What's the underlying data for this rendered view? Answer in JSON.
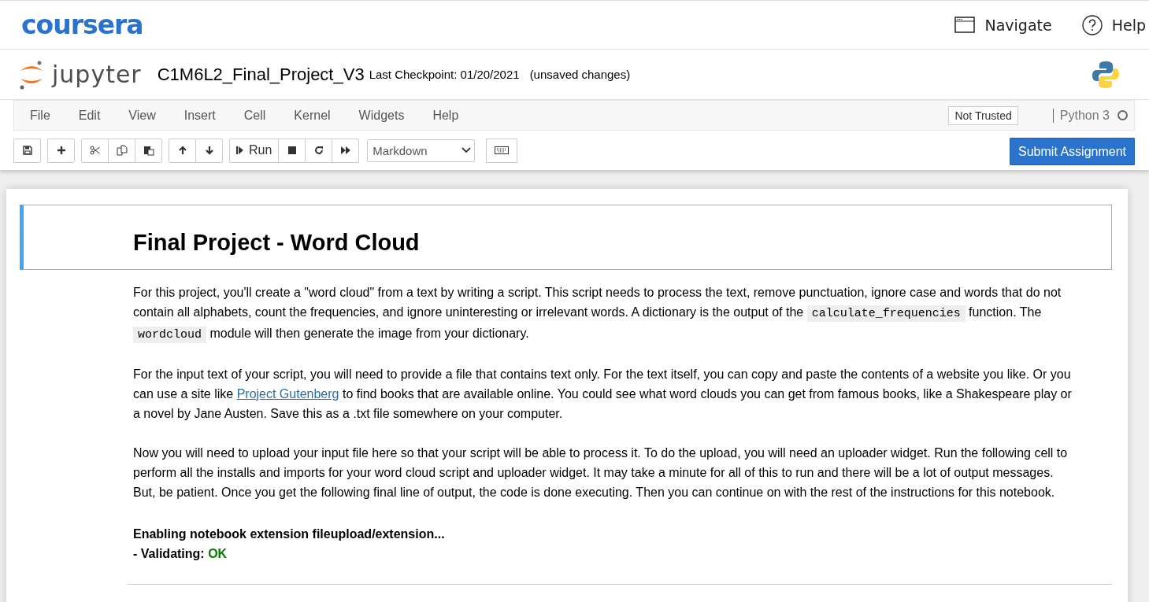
{
  "site_header": {
    "brand": "coursera",
    "links": [
      {
        "kind": "navigate",
        "label": "Navigate"
      },
      {
        "kind": "help",
        "label": "Help"
      }
    ]
  },
  "notebook_header": {
    "logo": "jupyter",
    "title": "C1M6L2_Final_Project_V3",
    "checkpoint": "Last Checkpoint: 01/20/2021",
    "status": "(unsaved changes)"
  },
  "menubar": {
    "items": [
      "File",
      "Edit",
      "View",
      "Insert",
      "Cell",
      "Kernel",
      "Widgets",
      "Help"
    ],
    "trust": "Not Trusted",
    "kernel": "Python 3",
    "kernel_busy": false
  },
  "toolbar": {
    "groups": [
      [
        {
          "kind": "save"
        }
      ],
      [
        {
          "kind": "add"
        }
      ],
      [
        {
          "kind": "cut"
        },
        {
          "kind": "copy"
        },
        {
          "kind": "paste"
        }
      ],
      [
        {
          "kind": "up"
        },
        {
          "kind": "down"
        }
      ],
      [
        {
          "kind": "run",
          "label": "Run"
        },
        {
          "kind": "stop"
        },
        {
          "kind": "restart"
        },
        {
          "kind": "fastforward"
        }
      ]
    ],
    "cell_type": "Markdown",
    "submit": "Submit Assignment"
  },
  "notebook": {
    "heading": "Final Project - Word Cloud",
    "heading_selected": true,
    "paragraphs": [
      [
        {
          "kind": "text",
          "text": "For this project, you'll create a \"word cloud\" from a text by writing a script. This script needs to process the text, remove punctuation, ignore case and words that do not contain all alphabets, count the frequencies, and ignore uninteresting or irrelevant words. A dictionary is the output of the "
        },
        {
          "kind": "code",
          "text": "calculate_frequencies"
        },
        {
          "kind": "text",
          "text": " function. The "
        },
        {
          "kind": "code",
          "text": "wordcloud"
        },
        {
          "kind": "text",
          "text": " module will then generate the image from your dictionary."
        }
      ],
      [
        {
          "kind": "text",
          "text": "For the input text of your script, you will need to provide a file that contains text only. For the text itself, you can copy and paste the contents of a website you like. Or you can use a site like "
        },
        {
          "kind": "link",
          "text": "Project Gutenberg"
        },
        {
          "kind": "text",
          "text": " to find books that are available online. You could see what word clouds you can get from famous books, like a Shakespeare play or a novel by Jane Austen. Save this as a .txt file somewhere on your computer."
        }
      ],
      [
        {
          "kind": "text",
          "text": "Now you will need to upload your input file here so that your script will be able to process it. To do the upload, you will need an uploader widget. Run the following cell to perform all the installs and imports for your word cloud script and uploader widget. It may take a minute for all of this to run and there will be a lot of output messages. But, be patient. Once you get the following final line of output, the code is done executing. Then you can continue on with the rest of the instructions for this notebook."
        }
      ]
    ],
    "output_lines": [
      [
        {
          "kind": "text",
          "text": "Enabling notebook extension fileupload/extension..."
        }
      ],
      [
        {
          "kind": "text",
          "text": "- Validating: "
        },
        {
          "kind": "ok",
          "text": "OK"
        }
      ]
    ]
  }
}
